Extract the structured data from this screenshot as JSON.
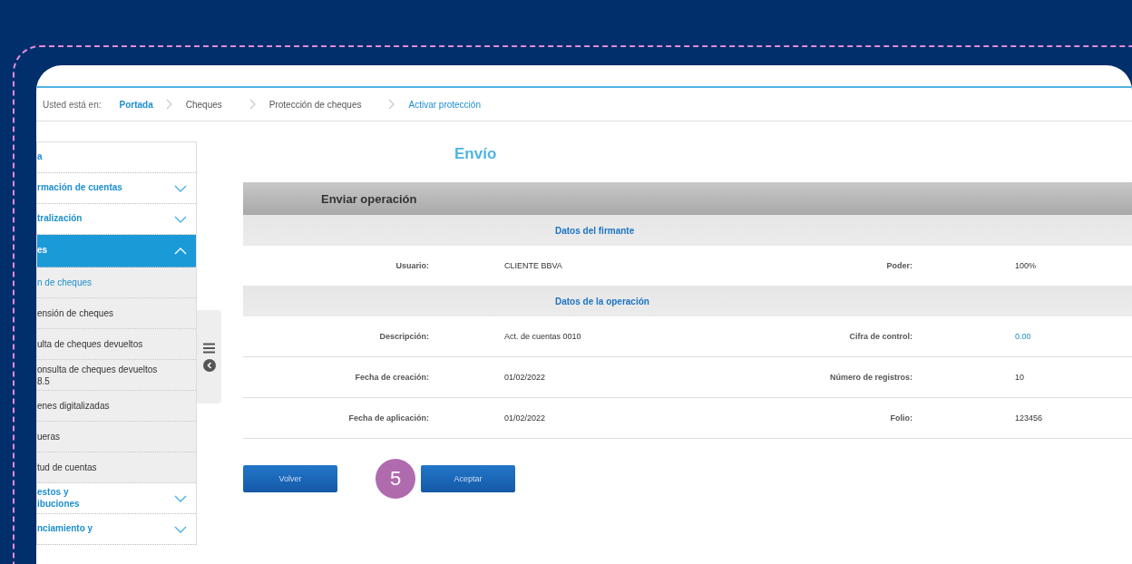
{
  "breadcrumb": {
    "prefix": "Usted está en:",
    "items": [
      {
        "label": "Portada",
        "kind": "link"
      },
      {
        "label": "Cheques",
        "kind": "plain"
      },
      {
        "label": "Protección de cheques",
        "kind": "plain"
      },
      {
        "label": "Activar protección",
        "kind": "current"
      }
    ]
  },
  "sidebar": {
    "items": [
      {
        "label": "a",
        "expandable": false,
        "expanded": false
      },
      {
        "label": "rmación de cuentas",
        "expandable": true,
        "expanded": false
      },
      {
        "label": "tralización",
        "expandable": true,
        "expanded": false
      },
      {
        "label": "es",
        "expandable": true,
        "expanded": true,
        "children": [
          {
            "label": "n de cheques",
            "selected": true
          },
          {
            "label": "ensión de cheques",
            "selected": false
          },
          {
            "label": "ulta de cheques devueltos",
            "selected": false
          },
          {
            "label": "onsulta de cheques devueltos\n8.5",
            "selected": false
          },
          {
            "label": "enes digitalizadas",
            "selected": false
          },
          {
            "label": "ueras",
            "selected": false
          },
          {
            "label": "tud de cuentas",
            "selected": false
          }
        ]
      },
      {
        "label": "estos y\nibuciones",
        "expandable": true,
        "expanded": false
      },
      {
        "label": "nciamiento y",
        "expandable": true,
        "expanded": false
      }
    ]
  },
  "page_title": "Envío",
  "panel": {
    "title": "Enviar operación",
    "sections": [
      {
        "heading": "Datos del firmante",
        "rows": [
          {
            "label_1": "Usuario:",
            "value_1": "CLIENTE BBVA",
            "label_2": "Poder:",
            "value_2": "100%",
            "value_2_highlighted": false
          }
        ]
      },
      {
        "heading": "Datos de la operación",
        "rows": [
          {
            "label_1": "Descripción:",
            "value_1": "Act. de cuentas 0010",
            "label_2": "Cifra de control:",
            "value_2": "0.00",
            "value_2_highlighted": true
          },
          {
            "label_1": "Fecha de creación:",
            "value_1": "01/02/2022",
            "label_2": "Número de registros:",
            "value_2": "10",
            "value_2_highlighted": false
          },
          {
            "label_1": "Fecha de aplicación:",
            "value_1": "01/02/2022",
            "label_2": "Folio:",
            "value_2": "123456",
            "value_2_highlighted": false
          }
        ]
      }
    ]
  },
  "buttons": [
    "Volver",
    "Aceptar"
  ],
  "step_badge": "5"
}
